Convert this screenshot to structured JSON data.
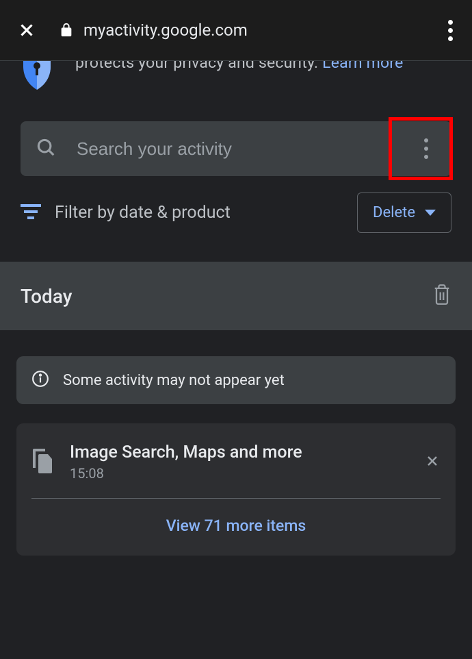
{
  "browser": {
    "url": "myactivity.google.com"
  },
  "banner": {
    "text_prefix": "protects your privacy and security. ",
    "learn_more": "Learn more"
  },
  "search": {
    "placeholder": "Search your activity"
  },
  "filter": {
    "label": "Filter by date & product",
    "delete_label": "Delete"
  },
  "section": {
    "title": "Today"
  },
  "notice": {
    "text": "Some activity may not appear yet"
  },
  "activity": {
    "title": "Image Search, Maps and more",
    "time": "15:08",
    "view_more": "View 71 more items"
  }
}
